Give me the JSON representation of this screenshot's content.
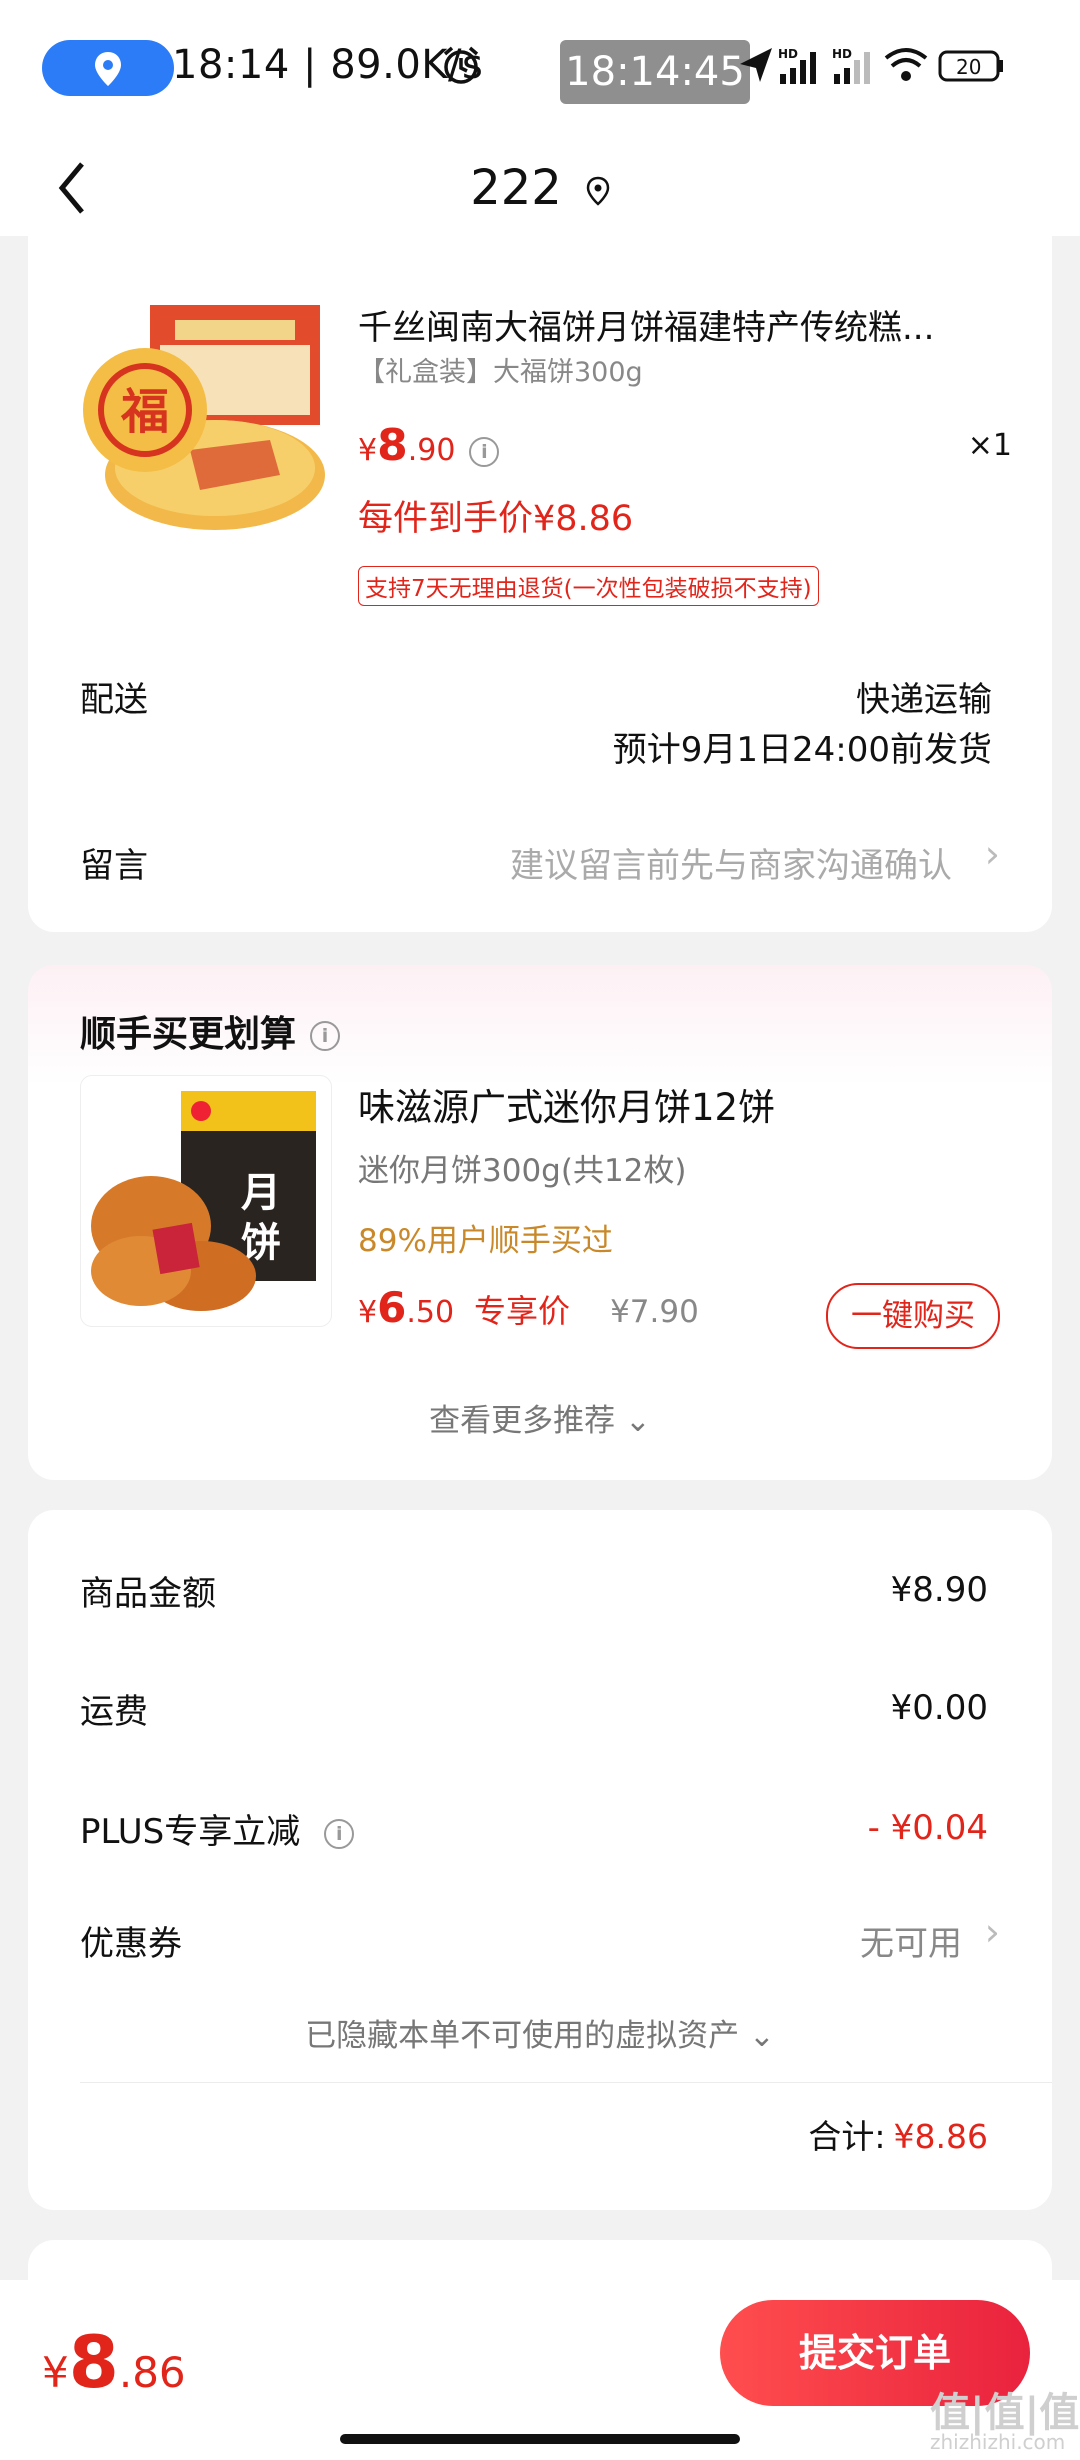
{
  "status_bar": {
    "time": "18:14",
    "separator": "|",
    "speed": "89.0K/s",
    "clock_overlay": "18:14:45",
    "battery": "20",
    "icons": [
      "location-pill-icon",
      "alarm-icon",
      "navigation-icon",
      "signal-hd-icon",
      "signal-hd-icon",
      "wifi-icon",
      "battery-icon"
    ]
  },
  "nav": {
    "title": "222",
    "icons": [
      "back-icon",
      "location-pin-icon"
    ]
  },
  "product": {
    "title": "千丝闽南大福饼月饼福建特产传统糕...",
    "spec": "【礼盒装】大福饼300g",
    "price_symbol": "¥",
    "price_int": "8",
    "price_dec": ".90",
    "qty": "×1",
    "final_price": "每件到手价¥8.86",
    "tag": "支持7天无理由退货(一次性包装破损不支持)"
  },
  "delivery": {
    "label": "配送",
    "method": "快递运输",
    "eta": "预计9月1日24:00前发货"
  },
  "message": {
    "label": "留言",
    "placeholder": "建议留言前先与商家沟通确认"
  },
  "recommend": {
    "title": "顺手买更划算",
    "name": "味滋源广式迷你月饼12饼",
    "spec": "迷你月饼300g(共12枚)",
    "rate": "89%用户顺手买过",
    "price_symbol": "¥",
    "price_int": "6",
    "price_dec": ".50",
    "price_label": "专享价",
    "orig_price": "¥7.90",
    "buy_button": "一键购买",
    "more": "查看更多推荐 ⌄"
  },
  "summary": {
    "goods_label": "商品金额",
    "goods_value": "¥8.90",
    "shipping_label": "运费",
    "shipping_value": "¥0.00",
    "plus_label": "PLUS专享立减",
    "plus_value": "- ¥0.04",
    "coupon_label": "优惠券",
    "coupon_value": "无可用",
    "hidden_note": "已隐藏本单不可使用的虚拟资产 ⌄",
    "total_label": "合计:",
    "total_value": "¥8.86"
  },
  "bottom": {
    "price_symbol": "¥",
    "price_int": "8",
    "price_dec": ".86",
    "submit": "提交订单"
  },
  "watermark": {
    "logo": "值|值|值",
    "site": "zhizhizhi.com"
  },
  "colors": {
    "accent": "#e1251b",
    "rate": "#c9892a",
    "blue_pill": "#2b7cf6"
  }
}
